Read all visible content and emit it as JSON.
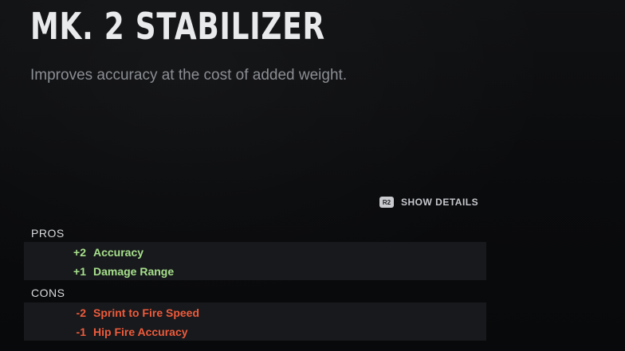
{
  "attachment": {
    "title": "MK. 2 STABILIZER",
    "description": "Improves accuracy at the cost of added weight."
  },
  "show_details": {
    "button_glyph": "R2",
    "button_icon": "r2-trigger-icon",
    "label": "SHOW DETAILS"
  },
  "pros": {
    "label": "PROS",
    "items": [
      {
        "value": "+2",
        "name": "Accuracy"
      },
      {
        "value": "+1",
        "name": "Damage Range"
      }
    ]
  },
  "cons": {
    "label": "CONS",
    "items": [
      {
        "value": "-2",
        "name": "Sprint to Fire Speed"
      },
      {
        "value": "-1",
        "name": "Hip Fire Accuracy"
      }
    ]
  },
  "colors": {
    "pro": "#a7e08c",
    "con": "#ef5b3c",
    "title": "#e9eaec",
    "panel": "#17191c"
  }
}
